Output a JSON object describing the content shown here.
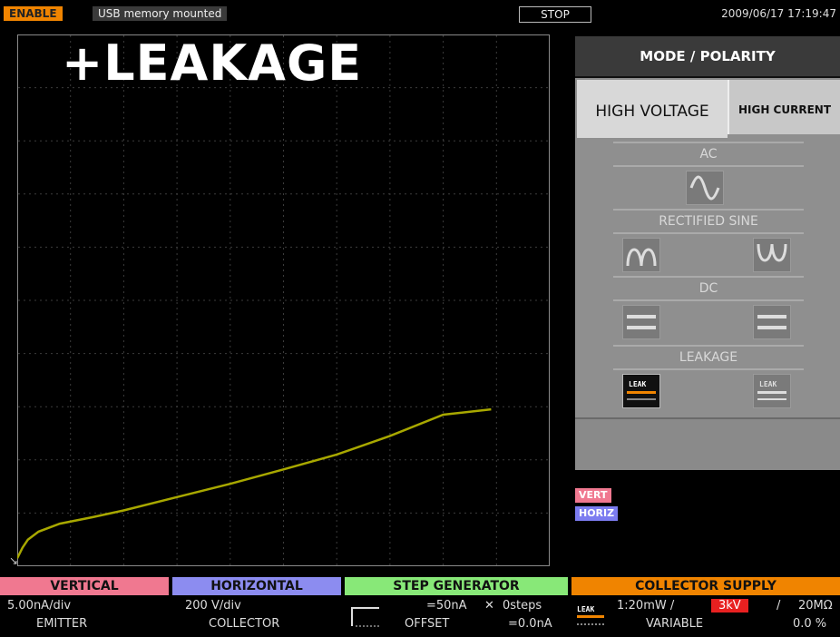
{
  "topbar": {
    "enable_label": "ENABLE",
    "status_message": "USB memory mounted",
    "stop_label": "STOP",
    "datetime": "2009/06/17 17:19:47"
  },
  "plot": {
    "title": "+LEAKAGE",
    "origin_marker": "↘",
    "trace_color": "#a8a800",
    "grid_color": "#3c3c3c"
  },
  "chart_data": {
    "type": "line",
    "title": "+LEAKAGE",
    "xlabel": "",
    "ylabel": "",
    "grid": true,
    "x_divisions": 10,
    "y_divisions": 10,
    "xlim": [
      0,
      10
    ],
    "ylim": [
      0,
      10
    ],
    "series": [
      {
        "x": [
          0,
          0.1,
          0.2,
          0.4,
          0.8,
          1.4,
          2,
          3,
          4,
          5,
          6,
          7,
          8,
          8.9
        ],
        "y": [
          0.15,
          0.35,
          0.5,
          0.65,
          0.8,
          0.92,
          1.05,
          1.3,
          1.55,
          1.82,
          2.1,
          2.45,
          2.85,
          2.95
        ]
      }
    ]
  },
  "mode_panel": {
    "header": "MODE / POLARITY",
    "tabs": [
      {
        "label": "HIGH VOLTAGE",
        "selected": true
      },
      {
        "label": "HIGH CURRENT",
        "selected": false
      }
    ],
    "sections": [
      {
        "label": "AC"
      },
      {
        "label": "RECTIFIED SINE"
      },
      {
        "label": "DC"
      },
      {
        "label": "LEAKAGE"
      }
    ],
    "leak_icon_text": "LEAK",
    "selected_mode": "leakage-positive"
  },
  "badges": {
    "vert": "VERT",
    "horiz": "HORIZ"
  },
  "bottom": {
    "vertical": {
      "title": "VERTICAL",
      "value": "5.00nA/div",
      "terminal": "EMITTER",
      "color": "#f07890"
    },
    "horizontal": {
      "title": "HORIZONTAL",
      "value": "200 V/div",
      "terminal": "COLLECTOR",
      "color": "#8c8cf0"
    },
    "step": {
      "title": "STEP GENERATOR",
      "amplitude": "=50nA",
      "steps": "0steps",
      "offset_label": "OFFSET",
      "offset_value": "=0.0nA",
      "color": "#88e878"
    },
    "collector": {
      "title": "COLLECTOR SUPPLY",
      "icon_text": "LEAK",
      "power": "1:20mW /",
      "voltage": "3kV",
      "resistance": "20MΩ",
      "mode": "VARIABLE",
      "percent": "0.0 %",
      "color": "#f08400",
      "voltage_color": "#e82020"
    }
  }
}
